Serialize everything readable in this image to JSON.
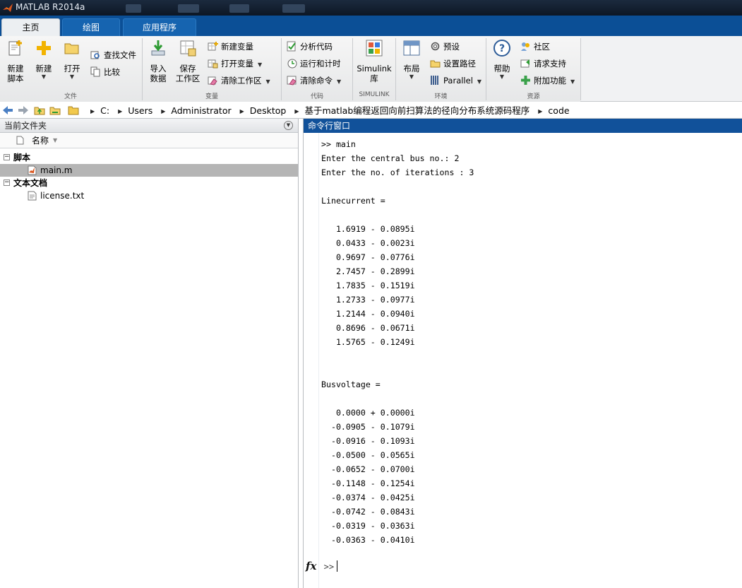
{
  "window": {
    "title": "MATLAB R2014a"
  },
  "tabs": [
    {
      "label": "主页"
    },
    {
      "label": "绘图"
    },
    {
      "label": "应用程序"
    }
  ],
  "ribbon": {
    "file": {
      "new_script": "新建\n脚本",
      "new": "新建",
      "open": "打开",
      "find_files": "查找文件",
      "compare": "比较",
      "group_label": "文件"
    },
    "variable": {
      "import": "导入\n数据",
      "save_ws": "保存\n工作区",
      "new_var": "新建变量",
      "open_var": "打开变量",
      "clear_ws": "清除工作区",
      "group_label": "变量"
    },
    "code": {
      "analyze": "分析代码",
      "run_time": "运行和计时",
      "clear_cmd": "清除命令",
      "group_label": "代码"
    },
    "simulink": {
      "library": "Simulink\n库",
      "group_label": "SIMULINK"
    },
    "environment": {
      "layout": "布局",
      "prefs": "预设",
      "set_path": "设置路径",
      "parallel": "Parallel",
      "group_label": "环境"
    },
    "resources": {
      "help": "帮助",
      "community": "社区",
      "support": "请求支持",
      "addons": "附加功能",
      "group_label": "资源"
    }
  },
  "path": {
    "crumbs": [
      "C:",
      "Users",
      "Administrator",
      "Desktop",
      "基于matlab编程返回向前扫算法的径向分布系统源码程序",
      "code"
    ]
  },
  "current_folder": {
    "title": "当前文件夹",
    "column_name": "名称",
    "groups": [
      {
        "label": "脚本",
        "files": [
          {
            "name": "main.m"
          }
        ]
      },
      {
        "label": "文本文档",
        "files": [
          {
            "name": "license.txt"
          }
        ]
      }
    ]
  },
  "command_window": {
    "title": "命令行窗口",
    "output": ">> main\nEnter the central bus no.: 2\nEnter the no. of iterations : 3\n\nLinecurrent =\n\n   1.6919 - 0.0895i\n   0.0433 - 0.0023i\n   0.9697 - 0.0776i\n   2.7457 - 0.2899i\n   1.7835 - 0.1519i\n   1.2733 - 0.0977i\n   1.2144 - 0.0940i\n   0.8696 - 0.0671i\n   1.5765 - 0.1249i\n\n\nBusvoltage =\n\n   0.0000 + 0.0000i\n  -0.0905 - 0.1079i\n  -0.0916 - 0.1093i\n  -0.0500 - 0.0565i\n  -0.0652 - 0.0700i\n  -0.1148 - 0.1254i\n  -0.0374 - 0.0425i\n  -0.0742 - 0.0843i\n  -0.0319 - 0.0363i\n  -0.0363 - 0.0410i",
    "fx_label": "fx",
    "prompt": ">>"
  },
  "colors": {
    "tab_strip": "#0b4f96",
    "cmd_header": "#11519a",
    "selected_row": "#b5b5b5"
  }
}
